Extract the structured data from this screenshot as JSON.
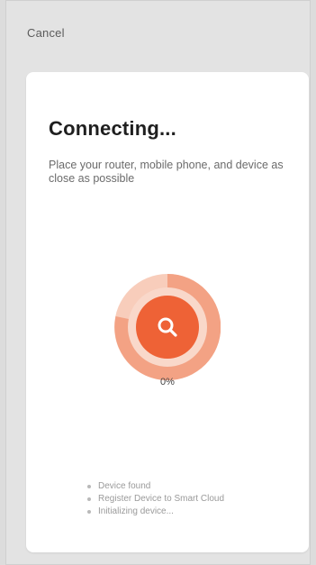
{
  "header": {
    "cancel_label": "Cancel"
  },
  "card": {
    "title": "Connecting...",
    "subtitle": "Place your router, mobile phone, and device as close as possible"
  },
  "progress": {
    "percent_label": "0%",
    "value": 0
  },
  "steps": [
    {
      "label": "Device found"
    },
    {
      "label": "Register Device to Smart Cloud"
    },
    {
      "label": "Initializing device..."
    }
  ],
  "icons": {
    "center": "search-icon"
  },
  "colors": {
    "accent": "#ee6236",
    "ring_light": "#f8c8b5",
    "ring_mid": "#f4a285"
  }
}
